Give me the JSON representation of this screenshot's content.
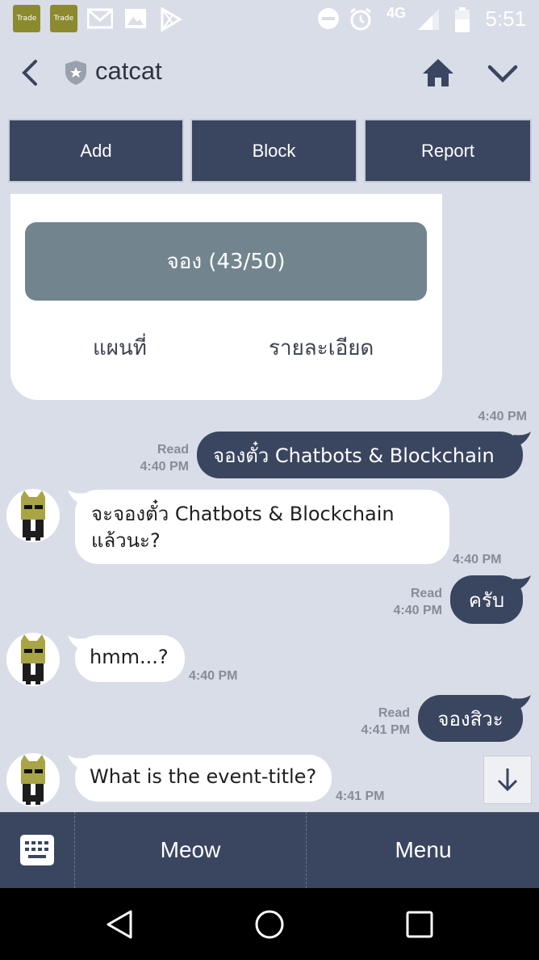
{
  "status_bar": {
    "time": "5:51",
    "network": "4G",
    "app_icons": [
      {
        "label": "Trade",
        "icon": "trade-app-icon"
      },
      {
        "label": "Trade",
        "icon": "trade-app-icon"
      }
    ],
    "icons": [
      "gmail-icon",
      "gallery-icon",
      "play-store-icon",
      "dnd-icon",
      "alarm-icon",
      "signal-icon",
      "battery-icon"
    ]
  },
  "header": {
    "title": "catcat",
    "icons": [
      "back-icon",
      "shield-icon",
      "home-icon",
      "chevron-down-icon"
    ]
  },
  "actions": {
    "add": "Add",
    "block": "Block",
    "report": "Report"
  },
  "card": {
    "primary": "จอง (43/50)",
    "link_map": "แผนที่",
    "link_details": "รายละเอียด",
    "time": "4:40 PM"
  },
  "messages": [
    {
      "side": "out",
      "text": "จองตั๋ว Chatbots & Blockchain",
      "read": "Read",
      "time": "4:40 PM"
    },
    {
      "side": "in",
      "text_line1": "จะจองตั๋ว Chatbots & Blockchain",
      "text_line2": "แล้วนะ?",
      "time": "4:40 PM"
    },
    {
      "side": "out",
      "text": "ครับ",
      "read": "Read",
      "time": "4:40 PM"
    },
    {
      "side": "in",
      "text": "hmm...?",
      "time": "4:40 PM"
    },
    {
      "side": "out",
      "text": "จองสิวะ",
      "read": "Read",
      "time": "4:41 PM"
    },
    {
      "side": "in",
      "text": "What is the event-title?",
      "time": "4:41 PM"
    }
  ],
  "bottom_bar": {
    "keyboard_icon": "keyboard-icon",
    "meow": "Meow",
    "menu": "Menu"
  },
  "nav_bar": {
    "icons": [
      "back-triangle-icon",
      "home-circle-icon",
      "recents-square-icon"
    ]
  },
  "colors": {
    "background": "#d9dde8",
    "accent_dark": "#3a4560",
    "card_button": "#72858f",
    "meta_text": "#858c99"
  }
}
